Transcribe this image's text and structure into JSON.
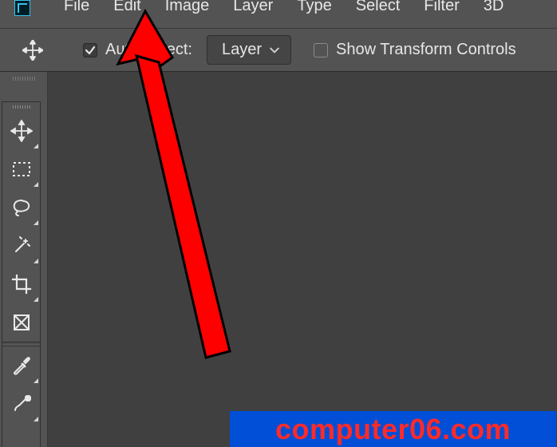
{
  "menubar": {
    "items": [
      "File",
      "Edit",
      "Image",
      "Layer",
      "Type",
      "Select",
      "Filter",
      "3D"
    ]
  },
  "optionsbar": {
    "autoselect_checked": true,
    "autoselect_label": "Auto-Select:",
    "select_value": "Layer",
    "show_transform_checked": false,
    "show_transform_label": "Show Transform Controls"
  },
  "tools": [
    {
      "name": "move-tool"
    },
    {
      "name": "marquee-tool"
    },
    {
      "name": "lasso-tool"
    },
    {
      "name": "quick-selection-tool"
    },
    {
      "name": "crop-tool"
    },
    {
      "name": "frame-tool"
    },
    {
      "name": "eyedropper-tool"
    },
    {
      "name": "brush-tool"
    }
  ],
  "watermark": {
    "text": "computer06.com"
  }
}
